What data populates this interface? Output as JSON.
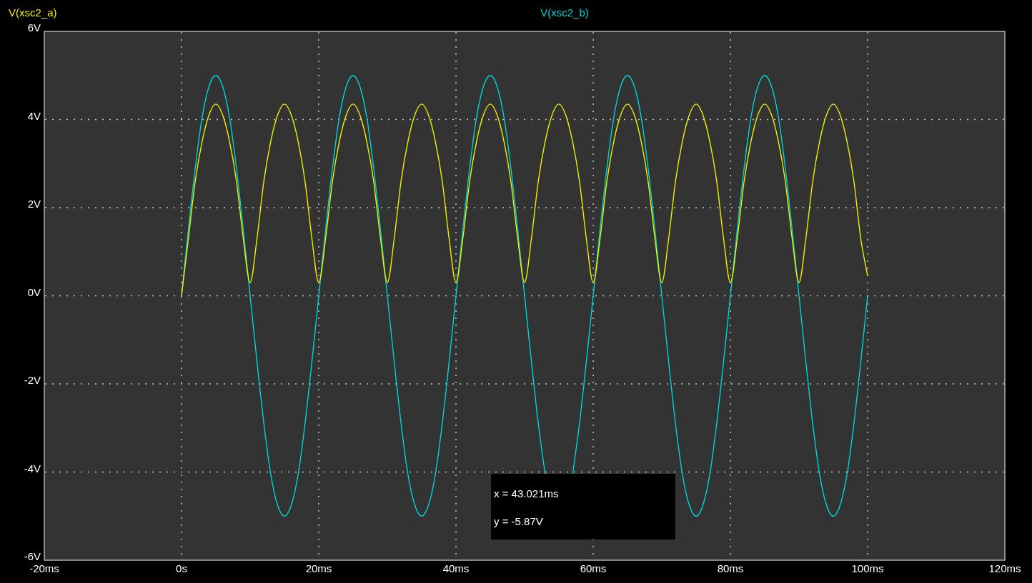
{
  "chart_data": {
    "type": "line",
    "grid": true,
    "xlim": [
      -20,
      120
    ],
    "ylim": [
      -6,
      6
    ],
    "xticks": [
      {
        "value": -20,
        "label": "-20ms"
      },
      {
        "value": 0,
        "label": "0s"
      },
      {
        "value": 20,
        "label": "20ms"
      },
      {
        "value": 40,
        "label": "40ms"
      },
      {
        "value": 60,
        "label": "60ms"
      },
      {
        "value": 80,
        "label": "80ms"
      },
      {
        "value": 100,
        "label": "100ms"
      },
      {
        "value": 120,
        "label": "120ms"
      }
    ],
    "yticks": [
      {
        "value": -6,
        "label": "-6V"
      },
      {
        "value": -4,
        "label": "-4V"
      },
      {
        "value": -2,
        "label": "-2V"
      },
      {
        "value": 0,
        "label": "0V"
      },
      {
        "value": 2,
        "label": "2V"
      },
      {
        "value": 4,
        "label": "4V"
      },
      {
        "value": 6,
        "label": "6V"
      }
    ],
    "x": [
      0,
      1,
      2,
      3,
      4,
      5,
      6,
      7,
      8,
      9,
      10,
      11,
      12,
      13,
      14,
      15,
      16,
      17,
      18,
      19,
      20,
      21,
      22,
      23,
      24,
      25,
      26,
      27,
      28,
      29,
      30,
      31,
      32,
      33,
      34,
      35,
      36,
      37,
      38,
      39,
      40,
      41,
      42,
      43,
      44,
      45,
      46,
      47,
      48,
      49,
      50,
      51,
      52,
      53,
      54,
      55,
      56,
      57,
      58,
      59,
      60,
      61,
      62,
      63,
      64,
      65,
      66,
      67,
      68,
      69,
      70,
      71,
      72,
      73,
      74,
      75,
      76,
      77,
      78,
      79,
      80,
      81,
      82,
      83,
      84,
      85,
      86,
      87,
      88,
      89,
      90,
      91,
      92,
      93,
      94,
      95,
      96,
      97,
      98,
      99,
      100
    ],
    "series": [
      {
        "name": "V(xsc2_a)",
        "color": "#f0f000",
        "values": [
          0,
          1.3,
          2.6,
          3.5,
          4.1,
          4.35,
          4.1,
          3.5,
          2.6,
          1.3,
          0.3,
          1.3,
          2.6,
          3.5,
          4.1,
          4.35,
          4.1,
          3.5,
          2.6,
          1.3,
          0.3,
          1.3,
          2.6,
          3.5,
          4.1,
          4.35,
          4.1,
          3.5,
          2.6,
          1.3,
          0.3,
          1.3,
          2.6,
          3.5,
          4.1,
          4.35,
          4.1,
          3.5,
          2.6,
          1.3,
          0.3,
          1.3,
          2.6,
          3.5,
          4.1,
          4.35,
          4.1,
          3.5,
          2.6,
          1.3,
          0.3,
          1.3,
          2.6,
          3.5,
          4.1,
          4.35,
          4.1,
          3.5,
          2.6,
          1.3,
          0.3,
          1.3,
          2.6,
          3.5,
          4.1,
          4.35,
          4.1,
          3.5,
          2.6,
          1.3,
          0.3,
          1.3,
          2.6,
          3.5,
          4.1,
          4.35,
          4.1,
          3.5,
          2.6,
          1.3,
          0.3,
          1.3,
          2.6,
          3.5,
          4.1,
          4.35,
          4.1,
          3.5,
          2.6,
          1.3,
          0.3,
          1.3,
          2.6,
          3.5,
          4.1,
          4.35,
          4.1,
          3.5,
          2.6,
          1.3,
          0.45
        ]
      },
      {
        "name": "V(xsc2_b)",
        "color": "#00d4d4",
        "values": [
          0,
          1.5,
          2.9,
          4.05,
          4.75,
          5,
          4.75,
          4.05,
          2.9,
          1.5,
          0,
          -1.5,
          -2.9,
          -4.05,
          -4.75,
          -5,
          -4.75,
          -4.05,
          -2.9,
          -1.5,
          0,
          1.5,
          2.9,
          4.05,
          4.75,
          5,
          4.75,
          4.05,
          2.9,
          1.5,
          0,
          -1.5,
          -2.9,
          -4.05,
          -4.75,
          -5,
          -4.75,
          -4.05,
          -2.9,
          -1.5,
          0,
          1.5,
          2.9,
          4.05,
          4.75,
          5,
          4.75,
          4.05,
          2.9,
          1.5,
          0,
          -1.5,
          -2.9,
          -4.05,
          null,
          null,
          null,
          -4.05,
          -2.9,
          -1.5,
          0,
          1.5,
          2.9,
          4.05,
          4.75,
          5,
          4.75,
          4.05,
          2.9,
          1.5,
          0,
          -1.5,
          -2.9,
          -4.05,
          -4.75,
          -5,
          -4.75,
          -4.05,
          -2.9,
          -1.5,
          0,
          1.5,
          2.9,
          4.05,
          4.75,
          5,
          4.75,
          4.05,
          2.9,
          1.5,
          0,
          -1.5,
          -2.9,
          -4.05,
          -4.75,
          -5,
          -4.75,
          -4.05,
          -2.9,
          -1.5,
          0
        ]
      }
    ]
  },
  "cursor_readout": {
    "x": "x = 43.021ms",
    "y": "y = -5.87V"
  }
}
